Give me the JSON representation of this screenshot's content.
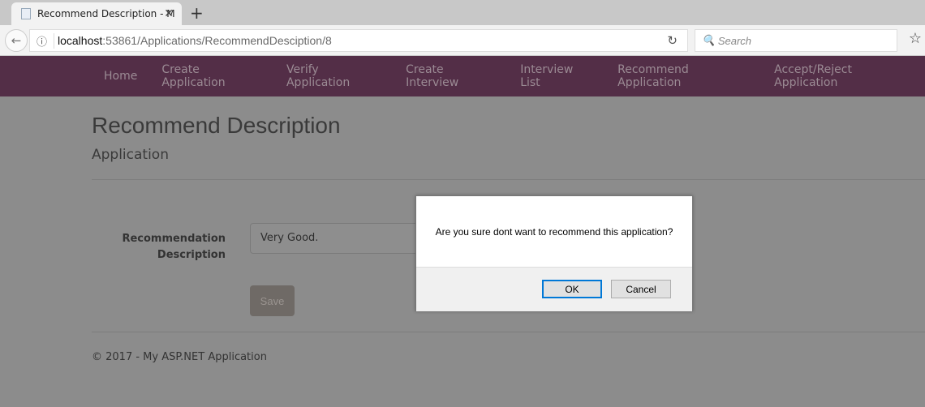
{
  "browser": {
    "tab_title": "Recommend Description - M",
    "url_host": "localhost",
    "url_rest": ":53861/Applications/RecommendDesciption/8",
    "search_placeholder": "Search"
  },
  "nav": [
    "Home",
    "Create Application",
    "Verify Application",
    "Create Interview",
    "Interview List",
    "Recommend Application",
    "Accept/Reject Application"
  ],
  "page": {
    "title": "Recommend Description",
    "subtitle": "Application",
    "label": "Recommendation Description",
    "input_value": "Very Good.",
    "save": "Save",
    "footer": "© 2017 - My ASP.NET Application"
  },
  "dialog": {
    "message": "Are you sure dont want to recommend this application?",
    "ok": "OK",
    "cancel": "Cancel"
  }
}
